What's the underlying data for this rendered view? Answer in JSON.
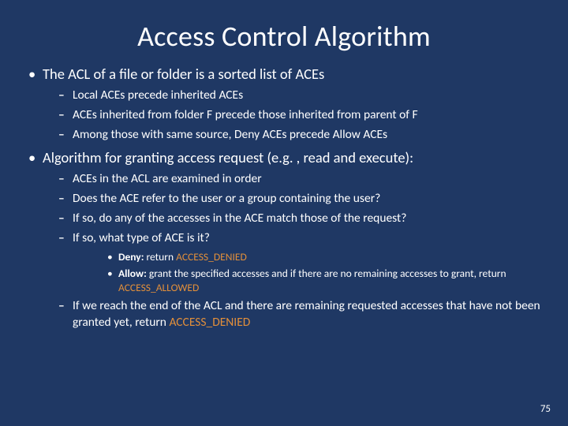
{
  "title": "Access Control Algorithm",
  "pagenum": "75",
  "b1": {
    "text": "The ACL of a file or folder is a sorted list of ACEs",
    "s1": "Local ACEs precede inherited ACEs",
    "s2": "ACEs inherited from folder F precede those inherited from parent of F",
    "s3": "Among those with same source, Deny ACEs precede Allow ACEs"
  },
  "b2": {
    "text": "Algorithm for granting access request (e.g. , read and execute):",
    "s1": "ACEs in the ACL are examined in order",
    "s2": "Does the ACE refer to the user or a group containing the user?",
    "s3": "If so, do any of the accesses in the ACE match those of the request?",
    "s4": "If so, what type of ACE is it?",
    "deny_label": "Deny:",
    "deny_rest": " return ",
    "deny_kw": "ACCESS_DENIED",
    "allow_label": "Allow:",
    "allow_rest": " grant the specified accesses and if there are no remaining accesses to grant, return ",
    "allow_kw": "ACCESS_ALLOWED",
    "s5a": "If we reach the end of the ACL and there are remaining requested accesses that have not been granted yet, return ",
    "s5kw": "ACCESS_DENIED"
  }
}
